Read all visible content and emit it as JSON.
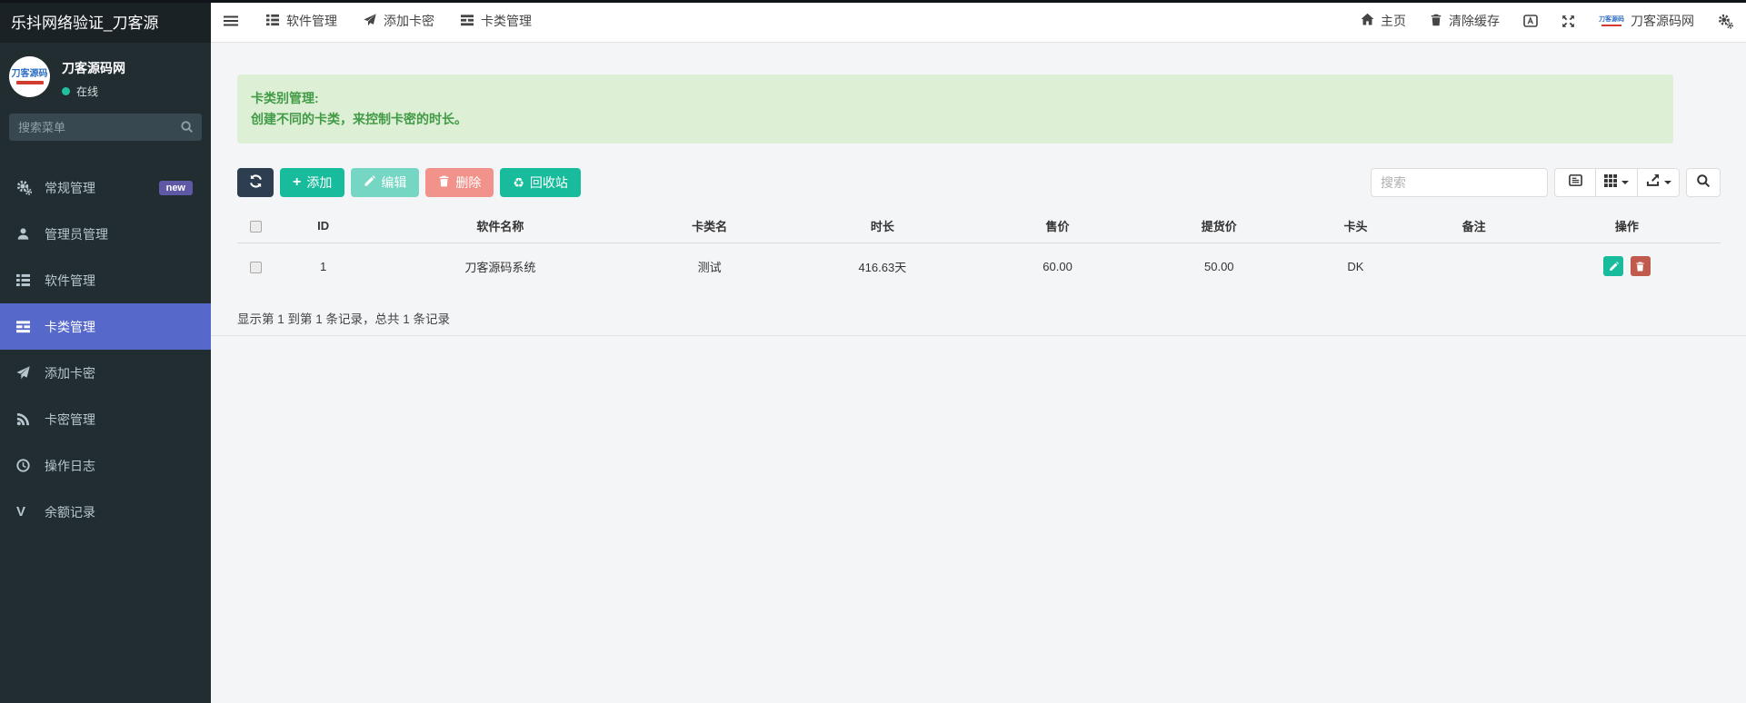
{
  "sidebar": {
    "brand": "乐抖网络验证_刀客源",
    "user": {
      "avatar_text": "刀客源码",
      "name": "刀客源码网",
      "status": "在线"
    },
    "search_placeholder": "搜索菜单",
    "items": [
      {
        "label": "常规管理",
        "icon": "gears-icon",
        "badge": "new"
      },
      {
        "label": "管理员管理",
        "icon": "user-icon"
      },
      {
        "label": "软件管理",
        "icon": "th-list-icon"
      },
      {
        "label": "卡类管理",
        "icon": "card-list-icon",
        "active": true
      },
      {
        "label": "添加卡密",
        "icon": "paper-plane-icon"
      },
      {
        "label": "卡密管理",
        "icon": "rss-icon"
      },
      {
        "label": "操作日志",
        "icon": "clock-icon"
      },
      {
        "label": "余额记录",
        "icon": "vimeo-v-icon"
      }
    ]
  },
  "navbar": {
    "tabs": [
      {
        "label": "软件管理",
        "icon": "th-list-icon"
      },
      {
        "label": "添加卡密",
        "icon": "paper-plane-icon"
      },
      {
        "label": "卡类管理",
        "icon": "card-list-icon"
      }
    ],
    "right": {
      "home": "主页",
      "clear_cache": "清除缓存",
      "brand": "刀客源码网"
    }
  },
  "alert": {
    "title": "卡类别管理:",
    "body": "创建不同的卡类，来控制卡密的时长。"
  },
  "toolbar": {
    "add": "添加",
    "edit": "编辑",
    "delete": "删除",
    "recycle": "回收站",
    "search_placeholder": "搜索"
  },
  "table": {
    "columns": [
      "ID",
      "软件名称",
      "卡类名",
      "时长",
      "售价",
      "提货价",
      "卡头",
      "备注",
      "操作"
    ],
    "rows": [
      {
        "id": "1",
        "software_name": "刀客源码系统",
        "card_type": "测试",
        "duration": "416.63天",
        "price": "60.00",
        "pickup_price": "50.00",
        "card_prefix": "DK",
        "remark": ""
      }
    ],
    "summary": "显示第 1 到第 1 条记录，总共 1 条记录"
  },
  "icons": {
    "recycle": "♻",
    "vimeo_v": "V",
    "plus": "+"
  },
  "colors": {
    "accent_green": "#18bc9c",
    "dark_button": "#2c3e50",
    "row_delete_red": "#bf5a4c",
    "sidebar_bg": "#222d32",
    "sidebar_active": "#5668c9",
    "badge_purple": "#5f59a5",
    "alert_bg": "#ddefd5",
    "alert_text": "#429b46",
    "online_dot": "#20bf9f"
  }
}
